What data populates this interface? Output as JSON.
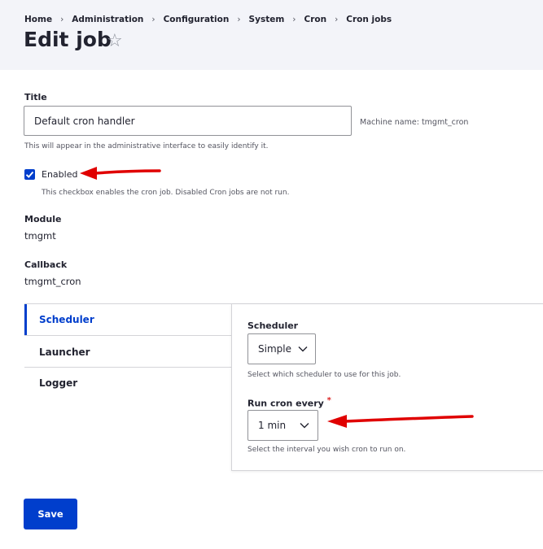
{
  "breadcrumb": [
    "Home",
    "Administration",
    "Configuration",
    "System",
    "Cron",
    "Cron jobs"
  ],
  "page": {
    "title": "Edit job",
    "star_glyph": "☆"
  },
  "form": {
    "title_label": "Title",
    "title_value": "Default cron handler",
    "machine_name": "Machine name: tmgmt_cron",
    "title_description": "This will appear in the administrative interface to easily identify it.",
    "enabled_label": "Enabled",
    "enabled_checked": true,
    "enabled_description": "This checkbox enables the cron job. Disabled Cron jobs are not run.",
    "module_label": "Module",
    "module_value": "tmgmt",
    "callback_label": "Callback",
    "callback_value": "tmgmt_cron"
  },
  "tabs": [
    {
      "label": "Scheduler",
      "active": true
    },
    {
      "label": "Launcher",
      "active": false
    },
    {
      "label": "Logger",
      "active": false
    }
  ],
  "scheduler_panel": {
    "scheduler_label": "Scheduler",
    "scheduler_value": "Simple",
    "scheduler_description": "Select which scheduler to use for this job.",
    "run_label": "Run cron every",
    "run_required": "*",
    "run_value": "1 min",
    "run_description": "Select the interval you wish cron to run on."
  },
  "actions": {
    "save_label": "Save"
  },
  "colors": {
    "accent": "#003ecc",
    "header_bg": "#f3f4f9",
    "annotation_arrow": "#e00000"
  }
}
